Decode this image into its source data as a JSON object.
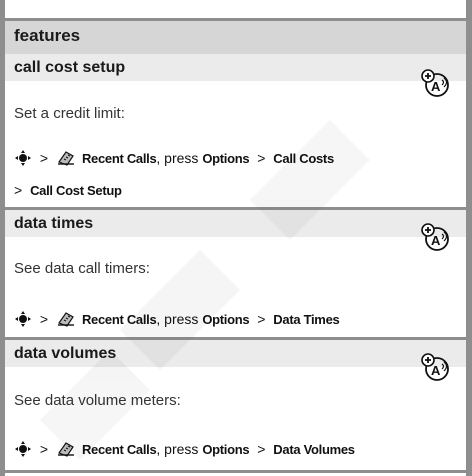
{
  "header": {
    "title": "features"
  },
  "features": [
    {
      "title": "call cost setup",
      "description": "Set a credit limit:",
      "path_line1": {
        "menu_label": "Recent Calls",
        "press": ", press",
        "options": "Options",
        "item": "Call Costs"
      },
      "path_line2": {
        "item": "Call Cost Setup"
      }
    },
    {
      "title": "data times",
      "description": "See data call timers:",
      "path_line1": {
        "menu_label": "Recent Calls",
        "press": ", press",
        "options": "Options",
        "item": "Data Times"
      }
    },
    {
      "title": "data volumes",
      "description": "See data volume meters:",
      "path_line1": {
        "menu_label": "Recent Calls",
        "press": ", press",
        "options": "Options",
        "item": "Data Volumes"
      }
    }
  ],
  "separator": ">",
  "icons": {
    "nav": "nav-key-icon",
    "phone": "recent-calls-phone-icon",
    "network": "network-feature-icon"
  },
  "colors": {
    "border": "#8e8e8e",
    "header_bg": "#d6d6d6",
    "row_title_bg": "#ebebeb"
  }
}
